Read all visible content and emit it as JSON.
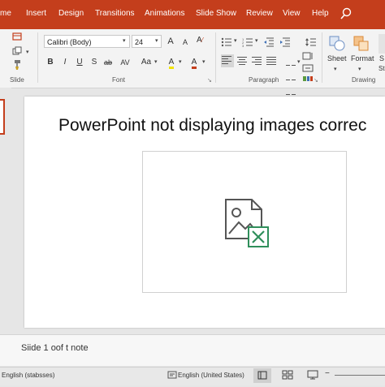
{
  "app": {
    "tabs": [
      "me",
      "Insert",
      "Design",
      "Transitions",
      "Animations",
      "Slide Show",
      "Review",
      "View",
      "Help"
    ]
  },
  "ribbon": {
    "groups": {
      "slide": "Slide",
      "font": "Font",
      "paragraph": "Paragraph",
      "drawing": "Drawing"
    },
    "font_name": "Calibri (Body)",
    "font_size": "24",
    "format_buttons": [
      "B",
      "I",
      "U",
      "S",
      "ab",
      "AV",
      "Aa"
    ],
    "grow_font": "A",
    "shrink_font": "A",
    "clear_format": "A",
    "font_color": "A",
    "highlight": "A",
    "drawing_buttons": {
      "sheet": "Sheet",
      "format": "Format",
      "third": "S",
      "third_sub": "St"
    }
  },
  "slide": {
    "title": "PowerPoint not displaying images correc",
    "image_state": "broken-image-icon"
  },
  "notes": {
    "text": "Siide 1 oof t note"
  },
  "status": {
    "left": "English (stabsses)",
    "language": "English (United States)"
  },
  "colors": {
    "accent": "#c43e1c",
    "broken_mark": "#2f8f5b"
  }
}
